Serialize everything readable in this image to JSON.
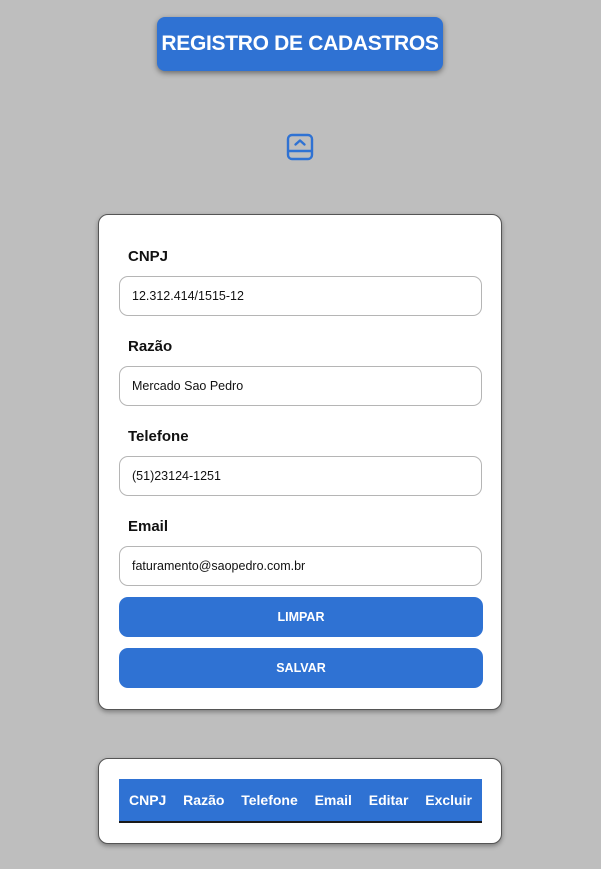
{
  "header": {
    "title": "REGISTRO DE CADASTROS"
  },
  "toggle": {
    "icon": "collapse-panel-icon"
  },
  "form": {
    "fields": [
      {
        "label": "CNPJ",
        "value": "12.312.414/1515-12"
      },
      {
        "label": "Razão",
        "value": "Mercado Sao Pedro"
      },
      {
        "label": "Telefone",
        "value": "(51)23124-1251"
      },
      {
        "label": "Email",
        "value": "faturamento@saopedro.com.br"
      }
    ],
    "buttons": {
      "clear_label": "LIMPAR",
      "save_label": "SALVAR"
    }
  },
  "table": {
    "columns": [
      "CNPJ",
      "Razão",
      "Telefone",
      "Email",
      "Editar",
      "Excluir"
    ]
  },
  "colors": {
    "background": "#bebebe",
    "accent": "#2f72d3",
    "card": "#ffffff"
  }
}
